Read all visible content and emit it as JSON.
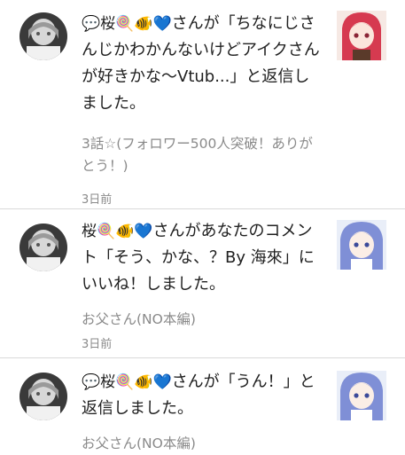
{
  "notifications": [
    {
      "user_icons": "💬桜🍭🐠💙",
      "message": "さんが「ちなにじさんじかわかんないけどアイクさんが好きかな〜Vtub...」と返信しました。",
      "work_title": "3話☆(フォロワー500人突破！ありがとう！)",
      "time": "3日前"
    },
    {
      "user_icons": "桜🍭🐠💙",
      "message": "さんがあなたのコメント「そう、かな、？By 海來」にいいね！しました。",
      "work_title": "お父さん(NO本編)",
      "time": "3日前"
    },
    {
      "user_icons": "💬桜🍭🐠💙",
      "message": "さんが「うん！」と返信しました。",
      "work_title": "お父さん(NO本編)",
      "time": ""
    }
  ],
  "colors": {
    "text": "#202020",
    "meta": "#8a8a8a",
    "divider": "#d9d9d9"
  }
}
